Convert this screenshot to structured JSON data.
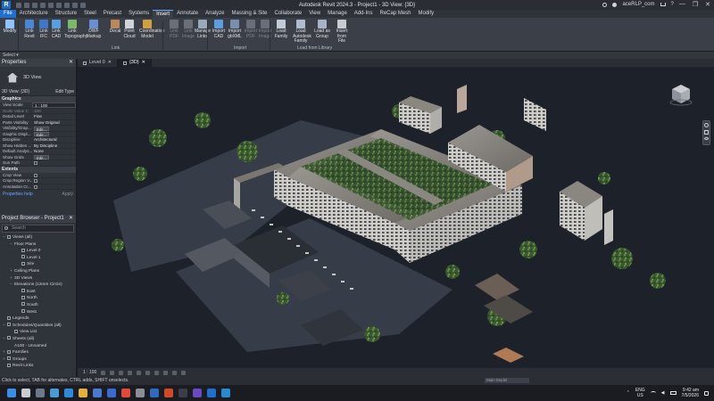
{
  "titlebar": {
    "app_icon": "R",
    "title": "Autodesk Revit 2024.3 - Project1 - 3D View: {3D}",
    "user": "aceRLP_com",
    "search_icon": "search-icon",
    "window_controls": [
      "—",
      "❐",
      "✕"
    ]
  },
  "ribbon_tabs": [
    "File",
    "Architecture",
    "Structure",
    "Steel",
    "Precast",
    "Systems",
    "Insert",
    "Annotate",
    "Analyze",
    "Massing & Site",
    "Collaborate",
    "View",
    "Manage",
    "Add-Ins",
    "ReCap Mesh",
    "Modify"
  ],
  "active_tab": "Insert",
  "ribbon": {
    "buttons": [
      {
        "label": "Modify",
        "color": "#8fc3ff"
      },
      {
        "label": "Link Revit",
        "color": "#4a86d6"
      },
      {
        "label": "Link IFC",
        "color": "#3e78c4"
      },
      {
        "label": "Link CAD",
        "color": "#5a9ee0"
      },
      {
        "label": "Link Topography",
        "color": "#7ab86a"
      },
      {
        "label": "DWF Markup",
        "color": "#6a8fd0"
      },
      {
        "label": "Decal",
        "color": "#b88a5a"
      },
      {
        "label": "Point Cloud",
        "color": "#cfd3d8"
      },
      {
        "label": "Coordination Model",
        "color": "#d0a040"
      },
      {
        "label": "Link PDF",
        "color": "#6a6e76",
        "dim": true
      },
      {
        "label": "Link Image",
        "color": "#6a6e76",
        "dim": true
      },
      {
        "label": "Manage Links",
        "color": "#9aa8bc"
      },
      {
        "label": "Import CAD",
        "color": "#5a9ee0"
      },
      {
        "label": "Import gbXML",
        "color": "#7a8fb0"
      },
      {
        "label": "Import PDF",
        "color": "#6a6e76",
        "dim": true
      },
      {
        "label": "Import Image",
        "color": "#6a6e76",
        "dim": true
      },
      {
        "label": "Load Family",
        "color": "#c2cad6"
      },
      {
        "label": "Load Autodesk Family",
        "color": "#b0bccb"
      },
      {
        "label": "Load as Group",
        "color": "#a6b4c6"
      },
      {
        "label": "Insert from File",
        "color": "#c8ccd2"
      }
    ],
    "panels": [
      "Select ▾",
      "Link",
      "Import",
      "Load from Library"
    ]
  },
  "properties": {
    "title": "Properties",
    "type_name": "3D View",
    "filter_value": "3D View: {3D}",
    "edit_type": "Edit Type",
    "groups": [
      {
        "name": "Graphics",
        "rows": [
          {
            "k": "View Scale",
            "v": "1 : 100",
            "kind": "field"
          },
          {
            "k": "Scale Value   1:",
            "v": "100",
            "dim": true
          },
          {
            "k": "Detail Level",
            "v": "Fine"
          },
          {
            "k": "Parts Visibility",
            "v": "Show Original"
          },
          {
            "k": "Visibility/Grap...",
            "v": "Edit...",
            "kind": "button"
          },
          {
            "k": "Graphic Displ...",
            "v": "Edit...",
            "kind": "button"
          },
          {
            "k": "Discipline",
            "v": "Architectural"
          },
          {
            "k": "Show Hidden ...",
            "v": "By Discipline"
          },
          {
            "k": "Default Analys...",
            "v": "None"
          },
          {
            "k": "Show Grids",
            "v": "Edit...",
            "kind": "button"
          },
          {
            "k": "Sun Path",
            "v": "",
            "kind": "check"
          }
        ]
      },
      {
        "name": "Extents",
        "rows": [
          {
            "k": "Crop View",
            "v": "",
            "kind": "check"
          },
          {
            "k": "Crop Region V...",
            "v": "",
            "kind": "check"
          },
          {
            "k": "Annotation Cr...",
            "v": "",
            "kind": "check"
          }
        ]
      }
    ],
    "help_link": "Properties help",
    "apply": "Apply"
  },
  "browser": {
    "title": "Project Browser - Project1",
    "search_placeholder": "Search",
    "tree": [
      {
        "t": "Views (all)",
        "lvl": 0,
        "tg": "−",
        "vi": true
      },
      {
        "t": "Floor Plans",
        "lvl": 1,
        "tg": "−"
      },
      {
        "t": "Level 0",
        "lvl": 2,
        "vi": true
      },
      {
        "t": "Level 1",
        "lvl": 2,
        "vi": true
      },
      {
        "t": "Site",
        "lvl": 2,
        "vi": true
      },
      {
        "t": "Ceiling Plans",
        "lvl": 1,
        "tg": "+"
      },
      {
        "t": "3D Views",
        "lvl": 1,
        "tg": "+"
      },
      {
        "t": "Elevations (12mm Circle)",
        "lvl": 1,
        "tg": "−"
      },
      {
        "t": "East",
        "lvl": 2,
        "vi": true
      },
      {
        "t": "North",
        "lvl": 2,
        "vi": true
      },
      {
        "t": "South",
        "lvl": 2,
        "vi": true
      },
      {
        "t": "West",
        "lvl": 2,
        "vi": true
      },
      {
        "t": "Legends",
        "lvl": 0,
        "tg": "",
        "vi": true
      },
      {
        "t": "Schedules/Quantities (all)",
        "lvl": 0,
        "tg": "−",
        "vi": true
      },
      {
        "t": "View List",
        "lvl": 1,
        "vi": true
      },
      {
        "t": "Sheets (all)",
        "lvl": 0,
        "tg": "−",
        "vi": true
      },
      {
        "t": "A100 - Unnamed",
        "lvl": 1
      },
      {
        "t": "Families",
        "lvl": 0,
        "tg": "+",
        "vi": true
      },
      {
        "t": "Groups",
        "lvl": 0,
        "tg": "+",
        "vi": true
      },
      {
        "t": "Revit Links",
        "lvl": 0,
        "tg": "",
        "vi": true
      }
    ]
  },
  "view_tabs": [
    {
      "label": "Level 0",
      "active": false
    },
    {
      "label": "{3D}",
      "active": true
    }
  ],
  "view_bar": {
    "scale": "1 : 100"
  },
  "status": {
    "message": "Click to select, TAB for alternates, CTRL adds, SHIFT unselects.",
    "main_model": "Main Model"
  },
  "taskbar": {
    "lang": "ENG",
    "region": "US",
    "time": "9:42 am",
    "date": "7/5/2026",
    "apps": [
      "windows-start-icon",
      "search-icon",
      "task-view-icon",
      "widgets-icon",
      "edge-icon",
      "file-explorer-icon",
      "store-icon",
      "mail-icon",
      "chrome-icon",
      "settings-icon",
      "security-icon",
      "office-icon",
      "terminal-icon",
      "dev-icon",
      "revit-icon",
      "recap-icon"
    ]
  },
  "colors": {
    "accent": "#1f6fce",
    "viewport_bg": "#1d2129",
    "panel_bg": "#2f333a"
  }
}
